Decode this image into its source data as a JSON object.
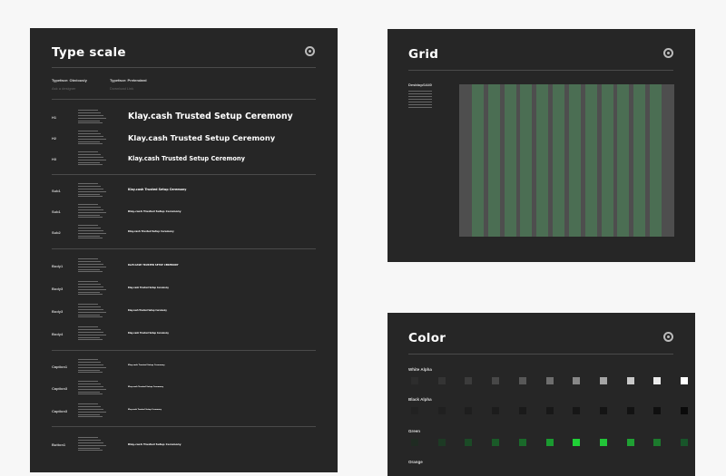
{
  "type_scale": {
    "title": "Type scale",
    "typefaces": [
      {
        "label": "Typeface: Obviously",
        "value": "Ask a designer"
      },
      {
        "label": "Typeface: Pretendard",
        "value": "Download Link"
      }
    ],
    "rows": [
      {
        "label": "H1",
        "sample": "Klay.cash Trusted Setup Ceremony",
        "size": 9.3
      },
      {
        "label": "H2",
        "sample": "Klay.cash Trusted Setup Ceremony",
        "size": 8.3
      },
      {
        "label": "H3",
        "sample": "Klay.cash Trusted Setup Ceremony",
        "size": 6.6
      },
      {
        "label": "Sub1",
        "sample": "Klay.cash Trusted Setup Ceremony",
        "size": 3.3
      },
      {
        "label": "Sub1",
        "sample": "Klay.cash Trusted Setup Ceremony",
        "size": 3
      },
      {
        "label": "Sub2",
        "sample": "Klay.cash Trusted Setup Ceremony",
        "size": 2.6
      },
      {
        "label": "Body1",
        "sample": "KLAY.CASH TRUSTED SETUP CEREMONY",
        "size": 2.5
      },
      {
        "label": "Body3",
        "sample": "Klay.cash Trusted Setup Ceremony",
        "size": 2.3
      },
      {
        "label": "Body3",
        "sample": "Klay.cash Trusted Setup Ceremony",
        "size": 2.2
      },
      {
        "label": "Body4",
        "sample": "Klay.cash Trusted Setup Ceremony",
        "size": 2.3
      },
      {
        "label": "Caption1",
        "sample": "Klay.cash Trusted Setup Ceremony",
        "size": 2.1
      },
      {
        "label": "Caption3",
        "sample": "Klay.cash Trusted Setup Ceremony",
        "size": 2
      },
      {
        "label": "Caption3",
        "sample": "Klay.cash Trusted Setup Ceremony",
        "size": 1.9
      },
      {
        "label": "Button1",
        "sample": "Klay.cash Trusted Setup Ceremony",
        "size": 3
      }
    ]
  },
  "grid": {
    "title": "Grid",
    "device_label": "Desktop/1440",
    "columns": 12,
    "column_color": "#4b6e53"
  },
  "color": {
    "title": "Color",
    "groups": [
      {
        "name": "White Alpha",
        "swatches": [
          "#2d2d2d",
          "#343434",
          "#3c3c3c",
          "#484848",
          "#585858",
          "#6e6e6e",
          "#888888",
          "#a5a5a5",
          "#c8c8c8",
          "#ebebeb",
          "#ffffff"
        ]
      },
      {
        "name": "Black Alpha",
        "swatches": [
          "#222222",
          "#202020",
          "#1e1e1e",
          "#1c1c1c",
          "#1a1a1a",
          "#181818",
          "#161616",
          "#141414",
          "#121212",
          "#0f0f0f",
          "#0a0a0a"
        ]
      },
      {
        "name": "Green",
        "swatches": [
          "#1f2b22",
          "#1d3a24",
          "#1b4a26",
          "#1a5a28",
          "#1a6a2a",
          "#1a9a30",
          "#1fd036",
          "#22c438",
          "#1fa033",
          "#1c7a2d",
          "#18552a"
        ]
      },
      {
        "name": "Orange",
        "swatches": []
      }
    ]
  }
}
